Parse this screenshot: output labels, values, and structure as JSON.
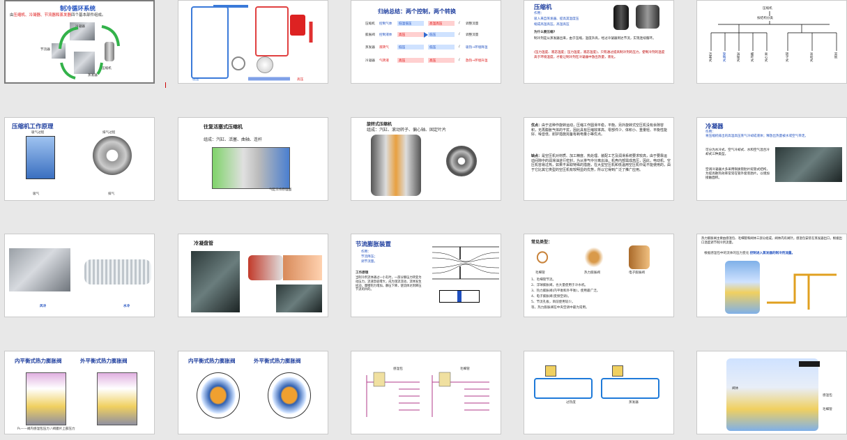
{
  "slides": [
    {
      "id": 1,
      "title": "制冷循环系统",
      "subtitle_prefix": "由",
      "subtitle_red": "压缩机、冷凝器、节流器和蒸发器",
      "subtitle_suffix": "四个基本部件组成。",
      "labels": [
        "冷凝器",
        "压缩机",
        "节流器",
        "蒸发器"
      ]
    },
    {
      "id": 2,
      "labels": [
        "冷凝器",
        "蒸发器",
        "高压",
        "低压"
      ]
    },
    {
      "id": 3,
      "title": "归纳总结：两个控制，两个转换",
      "rows": [
        {
          "name": "压缩机",
          "ctrl": "控制气体",
          "from": "低温低压",
          "to": "高温高压",
          "sep": "/",
          "note": "调整流量"
        },
        {
          "name": "膨胀阀",
          "ctrl": "控制液体",
          "from": "高压",
          "to": "低压",
          "sep": "/",
          "note": "调整流量"
        },
        {
          "name": "蒸发器",
          "ctrl": "液转气",
          "from": "低压",
          "to": "低压",
          "sep": "/",
          "note": "吸热→环境降温"
        },
        {
          "name": "冷凝器",
          "ctrl": "气转液",
          "from": "高压",
          "to": "高压",
          "sep": "/",
          "note": "放热→环境升温"
        }
      ]
    },
    {
      "id": 4,
      "title": "压缩机",
      "role_head": "作用：",
      "role_lines": [
        "吸入来自蒸发器、提高其温度压",
        "缩成高温高压。高温高压"
      ],
      "q": "为什么要压缩?",
      "para1": "制冷剂是从蒸发器出来，由于压缩，温度升高，经过冷凝器到达节流，实现连续循环。",
      "para2": "(压力温度、液态温度；压力温度，液态温度)，只有通过提高制冷剂的压力，使制冷剂的温度高于环境温度，才能让制冷剂在冷凝器中放出热量，液化。"
    },
    {
      "id": 5,
      "root": "压缩机",
      "level2": "按结构分类",
      "leaves": [
        "活塞式",
        "旋转式",
        "涡旋式",
        "螺杆式",
        "离心式",
        "转子式",
        "滚动式",
        "其他"
      ]
    },
    {
      "id": 6,
      "title": "压缩机工作原理",
      "labels": [
        "吸气过程",
        "排气过程",
        "吸气",
        "排气"
      ]
    },
    {
      "id": 7,
      "title": "往复活塞式压缩机",
      "sub": "组成：汽缸、活塞、曲轴、连杆",
      "caption": "气缸工作原理图"
    },
    {
      "id": 8,
      "title": "旋转式压缩机",
      "sub": "组成：汽缸、滚动转子、偏心轴、固定叶片"
    },
    {
      "id": 9,
      "p1_head": "优点：",
      "p1": "由于这种作旋转运动，压缩工作圆滑平稳，平衡。另外旋转式空压机没有余隙容积，无再膨胀气体的干扰，因此具有压缩效率高、零部件少、体积小、重量轻、平衡性能好、噪音低、耐护措施完备有耗电量小等优点。",
      "p2_head": "缺点：",
      "p2": "是空压机对材质、加工精度、热处理、装配工艺及润滑系统要求较高，由于要靠运动间隙中的润滑油进行密封，为从排气中分离出油，机壳内部需成高压，因此，电动机、空压机容易过热，如果不采取特殊的措施，在大型空压机和低温用空压机中是不能使用的，由于它比其它类型的空压机有较明显的优势，所以它得到广泛了推广应用。"
    },
    {
      "id": 10,
      "title": "冷凝器",
      "role_head": "作用：",
      "role": "将压缩机排出的高温高压蒸气冷却成液体；释放出热量被水或空气带走。",
      "t2": "可分为水冷式、空气冷却式、水和空气混合冷却式三种类型。",
      "t3": "空调冷凝器大多采用铜质管肋片蛇管式结构，为提高散热效率常常在管外套装肋片，以增加接触面积。"
    },
    {
      "id": 11,
      "labels": [
        "风冷",
        "水冷"
      ]
    },
    {
      "id": 12,
      "title": "冷凝盘管"
    },
    {
      "id": 13,
      "title": "节流膨胀装置",
      "role_head": "作用：",
      "role_lines": [
        "节流降压；",
        "调节流量。"
      ],
      "wp_head": "工作原理",
      "wp": "当制冷剂流体通过一小孔时，一部分静压力转变为动压力，流速急剧增大，成为湍流流动，流体发生扰动，摩擦阻力增加，静压下降，使流体达到降压节流的目的。"
    },
    {
      "id": 14,
      "title": "常见类型：",
      "items": [
        "毛细管",
        "热力膨胀阀",
        "电子膨胀阀"
      ],
      "list": [
        "1、毛细管节流。",
        "2、浮球膨胀阀，也大量使用于冷水机。",
        "3、热力膨胀阀(内平衡和外平衡)，使用最广泛。",
        "4、电子膨胀阀(变频空调)。",
        "5、节流孔板，目前使用较少。",
        "等，热力膨胀阀在中央空调中最为常用。"
      ]
    },
    {
      "id": 15,
      "lead": "热力膨胀阀主要由感温包、毛细管和阀体三部分组成，阀体内有阀针。感温包安装在蒸发器出口，根据出口温度调节制冷剂流量。",
      "summary": "根据感温包中的流体的压力变化",
      "highlight": "控制进入蒸发器的制冷剂流量。"
    },
    {
      "id": 16,
      "title_a": "内平衡式热力膨胀阀",
      "title_b": "外平衡式热力膨胀阀",
      "caption": "P₁——阀内感温包压力 / 阀膜片上部压力"
    },
    {
      "id": 17,
      "title_a": "内平衡式热力膨胀阀",
      "title_b": "外平衡式热力膨胀阀"
    },
    {
      "id": 18,
      "labels": [
        "感温包",
        "毛细管"
      ]
    },
    {
      "id": 19,
      "labels": [
        "过热度",
        "蒸发器"
      ]
    },
    {
      "id": 20,
      "labels": [
        "阀体",
        "感温包",
        "毛细管"
      ]
    }
  ]
}
